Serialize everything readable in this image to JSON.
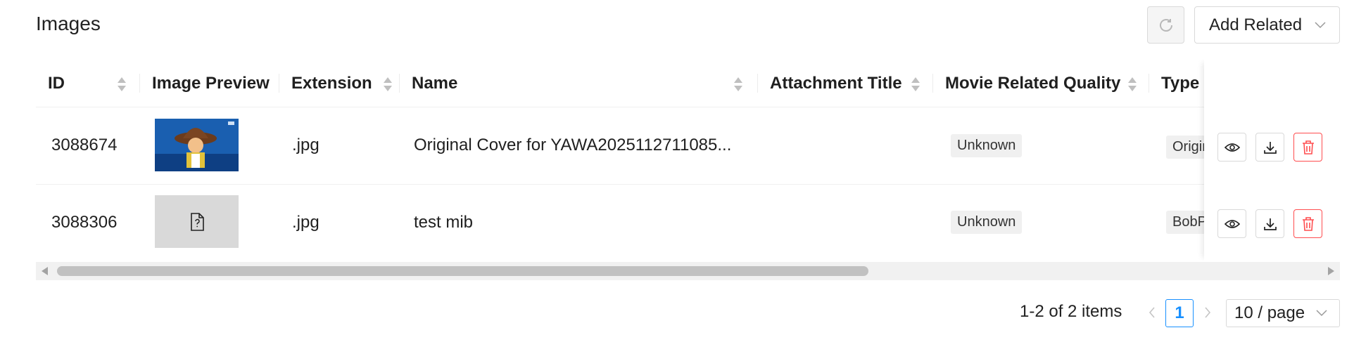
{
  "panel": {
    "title": "Images"
  },
  "toolbar": {
    "add_related_label": "Add Related"
  },
  "table": {
    "columns": [
      "ID",
      "Image Preview",
      "Extension",
      "Name",
      "Attachment Title",
      "Movie Related Quality",
      "Type"
    ],
    "rows": [
      {
        "id": "3088674",
        "extension": ".jpg",
        "name": "Original Cover for YAWA2025112711085...",
        "attachment_title": "",
        "quality": "Unknown",
        "type": "Original",
        "preview": "cowboy-character-image"
      },
      {
        "id": "3088306",
        "extension": ".jpg",
        "name": "test mib",
        "attachment_title": "",
        "quality": "Unknown",
        "type": "BobPhoto",
        "preview": "file-placeholder-icon"
      }
    ]
  },
  "pagination": {
    "total_text": "1-2 of 2 items",
    "current_page": "1",
    "page_size": "10 / page"
  },
  "colors": {
    "primary": "#1890ff",
    "danger": "#ff4d4f",
    "border": "#d9d9d9",
    "tag_bg": "#f0f0f0"
  },
  "icons": {
    "refresh": "refresh-icon",
    "dropdown": "chevron-down-icon",
    "view": "eye-icon",
    "download": "download-icon",
    "delete": "trash-icon"
  }
}
